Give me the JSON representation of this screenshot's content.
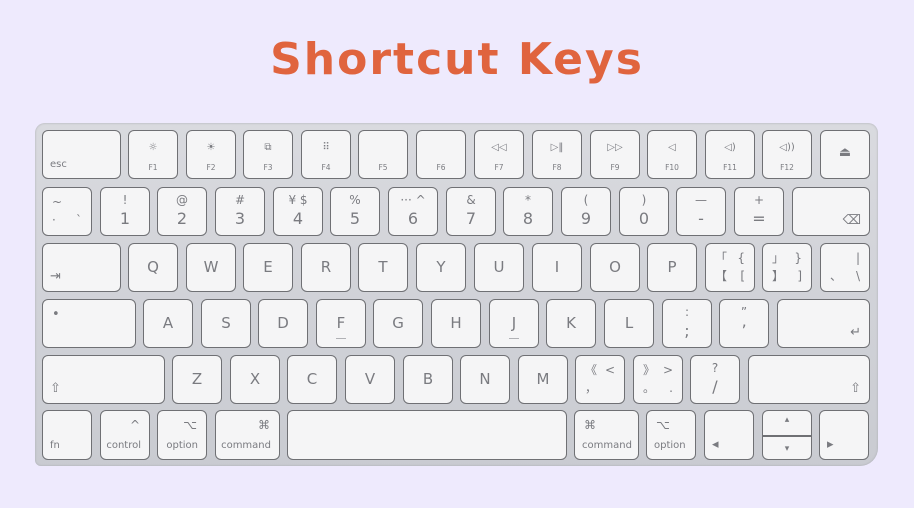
{
  "title": "Shortcut Keys",
  "colors": {
    "title": "#e0643e",
    "background": "#eeeafd",
    "key": "#f5f5f6",
    "legend": "#7a7b80"
  },
  "keyboard": {
    "function_row": [
      {
        "name": "esc",
        "label": "esc"
      },
      {
        "name": "f1",
        "icon": "☼",
        "icon_name": "brightness-down-icon",
        "label": "F1"
      },
      {
        "name": "f2",
        "icon": "☀",
        "icon_name": "brightness-up-icon",
        "label": "F2"
      },
      {
        "name": "f3",
        "icon": "⧉",
        "icon_name": "mission-control-icon",
        "label": "F3"
      },
      {
        "name": "f4",
        "icon": "⠿",
        "icon_name": "launchpad-icon",
        "label": "F4"
      },
      {
        "name": "f5",
        "label": "F5"
      },
      {
        "name": "f6",
        "label": "F6"
      },
      {
        "name": "f7",
        "icon": "◁◁",
        "icon_name": "rewind-icon",
        "label": "F7"
      },
      {
        "name": "f8",
        "icon": "▷‖",
        "icon_name": "play-pause-icon",
        "label": "F8"
      },
      {
        "name": "f9",
        "icon": "▷▷",
        "icon_name": "fast-forward-icon",
        "label": "F9"
      },
      {
        "name": "f10",
        "icon": "◁",
        "icon_name": "mute-icon",
        "label": "F10"
      },
      {
        "name": "f11",
        "icon": "◁)",
        "icon_name": "volume-down-icon",
        "label": "F11"
      },
      {
        "name": "f12",
        "icon": "◁))",
        "icon_name": "volume-up-icon",
        "label": "F12"
      },
      {
        "name": "eject",
        "icon": "⏏",
        "icon_name": "eject-icon"
      }
    ],
    "number_row": [
      {
        "name": "backtick",
        "tl": "~",
        "bl": "·",
        "br": "`"
      },
      {
        "name": "1",
        "top": "!",
        "bottom": "1"
      },
      {
        "name": "2",
        "top": "@",
        "bottom": "2"
      },
      {
        "name": "3",
        "top": "#",
        "bottom": "3"
      },
      {
        "name": "4",
        "top": "¥   $",
        "bottom": "4"
      },
      {
        "name": "5",
        "top": "%",
        "bottom": "5"
      },
      {
        "name": "6",
        "top": "···   ^",
        "bottom": "6"
      },
      {
        "name": "7",
        "top": "&",
        "bottom": "7"
      },
      {
        "name": "8",
        "top": "*",
        "bottom": "8"
      },
      {
        "name": "9",
        "top": "(",
        "bottom": "9"
      },
      {
        "name": "0",
        "top": ")",
        "bottom": "0"
      },
      {
        "name": "minus",
        "top": "—",
        "bottom": "-"
      },
      {
        "name": "equals",
        "top": "+",
        "bottom": "="
      },
      {
        "name": "delete",
        "icon": "⌫",
        "icon_name": "delete-icon"
      }
    ],
    "qwerty_row": [
      {
        "name": "tab",
        "icon": "⇥",
        "icon_name": "tab-icon"
      },
      {
        "name": "q",
        "label": "Q"
      },
      {
        "name": "w",
        "label": "W"
      },
      {
        "name": "e",
        "label": "E"
      },
      {
        "name": "r",
        "label": "R"
      },
      {
        "name": "t",
        "label": "T"
      },
      {
        "name": "y",
        "label": "Y"
      },
      {
        "name": "u",
        "label": "U"
      },
      {
        "name": "i",
        "label": "I"
      },
      {
        "name": "o",
        "label": "O"
      },
      {
        "name": "p",
        "label": "P"
      },
      {
        "name": "open-bracket",
        "tl": "「",
        "tr": "{",
        "bl": "【",
        "br": "["
      },
      {
        "name": "close-bracket",
        "tl": "」",
        "tr": "}",
        "bl": "】",
        "br": "]"
      },
      {
        "name": "backslash",
        "tr": "|",
        "bl": "、",
        "br": "\\"
      }
    ],
    "home_row": [
      {
        "name": "caps-lock",
        "icon": "•",
        "icon_name": "caps-lock-indicator-icon"
      },
      {
        "name": "a",
        "label": "A"
      },
      {
        "name": "s",
        "label": "S"
      },
      {
        "name": "d",
        "label": "D"
      },
      {
        "name": "f",
        "label": "F",
        "home": true
      },
      {
        "name": "g",
        "label": "G"
      },
      {
        "name": "h",
        "label": "H"
      },
      {
        "name": "j",
        "label": "J",
        "home": true
      },
      {
        "name": "k",
        "label": "K"
      },
      {
        "name": "l",
        "label": "L"
      },
      {
        "name": "semicolon",
        "top": ":",
        "bottom": ";"
      },
      {
        "name": "quote",
        "top": "”",
        "bottom": "’"
      },
      {
        "name": "return",
        "icon": "↵",
        "icon_name": "return-icon"
      }
    ],
    "shift_row": [
      {
        "name": "left-shift",
        "icon": "⇧",
        "icon_name": "shift-icon"
      },
      {
        "name": "z",
        "label": "Z"
      },
      {
        "name": "x",
        "label": "X"
      },
      {
        "name": "c",
        "label": "C"
      },
      {
        "name": "v",
        "label": "V"
      },
      {
        "name": "b",
        "label": "B"
      },
      {
        "name": "n",
        "label": "N"
      },
      {
        "name": "m",
        "label": "M"
      },
      {
        "name": "comma",
        "tl": "《",
        "tr": "<",
        "bl": "，"
      },
      {
        "name": "period",
        "tl": "》",
        "tr": ">",
        "bl": "。",
        "br": "."
      },
      {
        "name": "slash",
        "top": "?",
        "bottom": "/"
      },
      {
        "name": "right-shift",
        "icon": "⇧",
        "icon_name": "shift-icon"
      }
    ],
    "bottom_row": [
      {
        "name": "fn",
        "label": "fn"
      },
      {
        "name": "left-control",
        "icon": "^",
        "icon_name": "control-icon",
        "label": "control"
      },
      {
        "name": "left-option",
        "icon": "⌥",
        "icon_name": "option-icon",
        "label": "option"
      },
      {
        "name": "left-command",
        "icon": "⌘",
        "icon_name": "command-icon",
        "label": "command"
      },
      {
        "name": "space"
      },
      {
        "name": "right-command",
        "icon": "⌘",
        "icon_name": "command-icon",
        "label": "command"
      },
      {
        "name": "right-option",
        "icon": "⌥",
        "icon_name": "option-icon",
        "label": "option"
      },
      {
        "name": "left-arrow",
        "icon": "◂",
        "icon_name": "left-arrow-icon"
      },
      {
        "name": "up-down-arrow",
        "up": "▴",
        "down": "▾"
      },
      {
        "name": "right-arrow",
        "icon": "▸",
        "icon_name": "right-arrow-icon"
      }
    ]
  }
}
